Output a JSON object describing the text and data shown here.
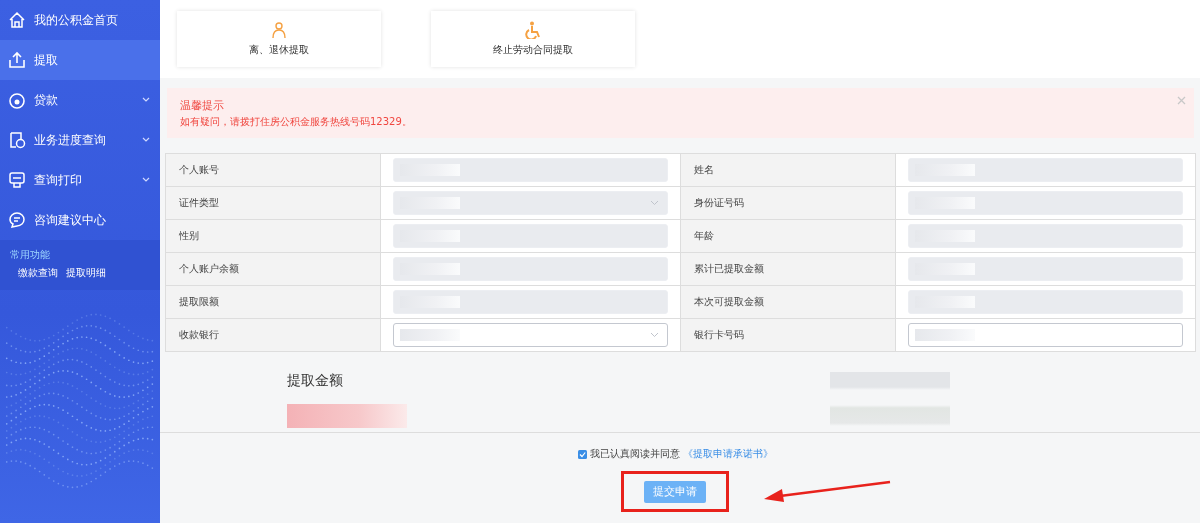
{
  "sidebar": {
    "items": [
      {
        "label": "我的公积金首页",
        "expandable": false,
        "selected": false
      },
      {
        "label": "提取",
        "expandable": false,
        "selected": true
      },
      {
        "label": "贷款",
        "expandable": true,
        "selected": false
      },
      {
        "label": "业务进度查询",
        "expandable": true,
        "selected": false
      },
      {
        "label": "查询打印",
        "expandable": true,
        "selected": false
      },
      {
        "label": "咨询建议中心",
        "expandable": false,
        "selected": false
      }
    ],
    "quick": {
      "title": "常用功能",
      "links": [
        "缴款查询",
        "提取明细"
      ]
    }
  },
  "cards": [
    {
      "label": "离、退休提取"
    },
    {
      "label": "终止劳动合同提取"
    }
  ],
  "alert": {
    "title": "温馨提示",
    "message": "如有疑问，请拨打住房公积金服务热线号码12329。"
  },
  "fields": [
    {
      "label": "个人账号",
      "kind": "text",
      "disabled": true,
      "redacted": true
    },
    {
      "label": "姓名",
      "kind": "text",
      "disabled": true,
      "redacted": true
    },
    {
      "label": "证件类型",
      "kind": "select",
      "disabled": true,
      "redacted": true
    },
    {
      "label": "身份证号码",
      "kind": "text",
      "disabled": true,
      "redacted": true
    },
    {
      "label": "性别",
      "kind": "text",
      "disabled": true,
      "redacted": true
    },
    {
      "label": "年龄",
      "kind": "text",
      "disabled": true,
      "redacted": true
    },
    {
      "label": "个人账户余额",
      "kind": "text",
      "disabled": true,
      "redacted": true
    },
    {
      "label": "累计已提取金额",
      "kind": "text",
      "disabled": true,
      "redacted": true
    },
    {
      "label": "提取限额",
      "kind": "text",
      "disabled": true,
      "redacted": true
    },
    {
      "label": "本次可提取金额",
      "kind": "text",
      "disabled": true,
      "redacted": true
    },
    {
      "label": "收款银行",
      "kind": "select",
      "disabled": false,
      "redacted": true
    },
    {
      "label": "银行卡号码",
      "kind": "text",
      "disabled": false,
      "redacted": true
    }
  ],
  "amount": {
    "label": "提取金额",
    "redacted": true
  },
  "agreement": {
    "checked": true,
    "text": "我已认真阅读并同意",
    "link": "《提取申请承诺书》"
  },
  "submit": {
    "label": "提交申请",
    "highlighted": true,
    "pointer_arrow": true
  }
}
